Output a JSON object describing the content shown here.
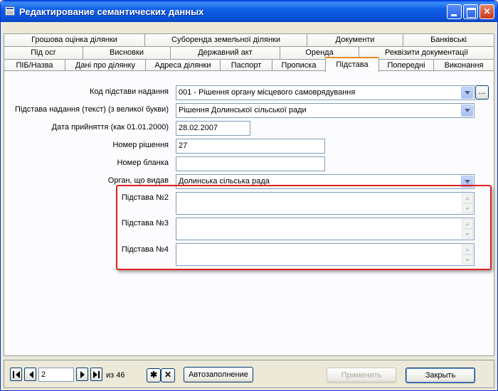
{
  "window": {
    "title": "Редактирование семантических данных",
    "minimize_icon": "minimize-icon",
    "maximize_icon": "maximize-icon",
    "close_icon": "close-icon"
  },
  "tabs": {
    "row1": [
      "Грошова оцінка ділянки",
      "Суборенда земельної ділянки",
      "Документи",
      "Банківські"
    ],
    "row2": [
      "Під осг",
      "Висновки",
      "Державний акт",
      "Оренда",
      "Реквізити документації"
    ],
    "row3": [
      "ПІБ/Назва",
      "Дані про ділянку",
      "Адреса ділянки",
      "Паспорт",
      "Прописка",
      "Підстава",
      "Попередні",
      "Виконання"
    ],
    "active": "Підстава"
  },
  "form": {
    "code_label": "Код підстави надання",
    "code_value": "001 - Рішення органу місцевого самоврядування",
    "text_label": "Підстава надання (текст) (з великої букви)",
    "text_value": "Рішення Долинської сільської ради",
    "date_label": "Дата прийняття (как 01.01.2000)",
    "date_value": "28.02.2007",
    "decision_label": "Номер рішення",
    "decision_value": "27",
    "blank_label": "Номер бланка",
    "blank_value": "",
    "organ_label": "Орган, що видав",
    "organ_value": "Долинська сільська рада",
    "basis2_label": "Підстава №2",
    "basis3_label": "Підстава №3",
    "basis4_label": "Підстава №4",
    "ellipsis": "..."
  },
  "footer": {
    "record_value": "2",
    "record_total": "из 46",
    "new_record": "✱",
    "delete_record": "✕",
    "autofill": "Автозаполнение",
    "apply": "Применить",
    "close": "Закрыть"
  }
}
